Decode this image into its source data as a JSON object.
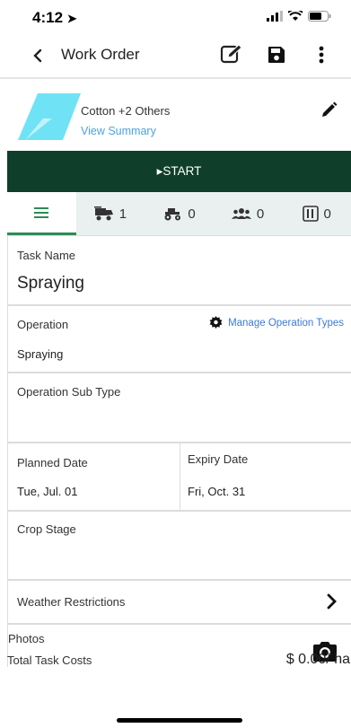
{
  "status": {
    "time": "4:12"
  },
  "nav": {
    "title": "Work Order"
  },
  "crop": {
    "title": "Cotton +2 Others",
    "summary_link": "View Summary"
  },
  "start": {
    "label": "▸START"
  },
  "tabs": [
    {
      "name": "details",
      "count": ""
    },
    {
      "name": "assets",
      "count": "1"
    },
    {
      "name": "equipment",
      "count": "0"
    },
    {
      "name": "people",
      "count": "0"
    },
    {
      "name": "inputs",
      "count": "0"
    }
  ],
  "form": {
    "task_name": {
      "label": "Task Name",
      "value": "Spraying"
    },
    "operation": {
      "label": "Operation",
      "value": "Spraying",
      "manage_link": "Manage Operation Types"
    },
    "operation_sub_type": {
      "label": "Operation Sub Type"
    },
    "planned_date": {
      "label": "Planned Date",
      "value": "Tue, Jul. 01"
    },
    "expiry_date": {
      "label": "Expiry Date",
      "value": "Fri, Oct. 31"
    },
    "crop_stage": {
      "label": "Crop Stage"
    },
    "weather_restrictions": {
      "label": "Weather Restrictions"
    },
    "photos": {
      "label": "Photos"
    }
  },
  "footer": {
    "label": "Total Task Costs",
    "value": "$ 0.00/ ha"
  },
  "colors": {
    "brand_dark": "#0f3f2b",
    "tab_active": "#2e8b57",
    "link": "#4aa3df",
    "logo": "#6fe3f5"
  }
}
